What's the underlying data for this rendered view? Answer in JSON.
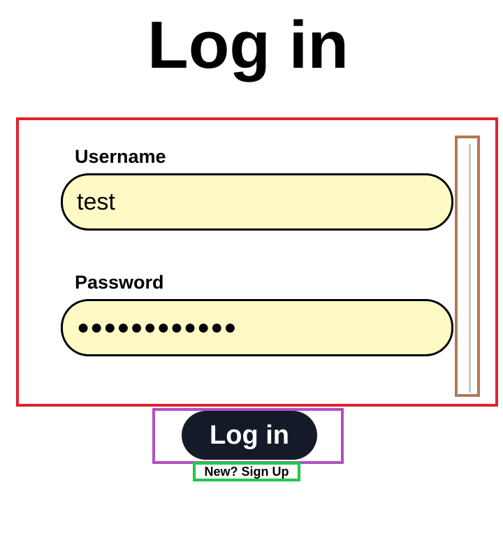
{
  "page": {
    "title": "Log in"
  },
  "form": {
    "username": {
      "label": "Username",
      "value": "test"
    },
    "password": {
      "label": "Password",
      "value": "●●●●●●●●●●●●"
    },
    "submit_label": "Log in",
    "signup_label": "New? Sign Up"
  },
  "colors": {
    "form_border": "#e0222f",
    "input_background": "#fefac6",
    "scroll_border": "#b07a56",
    "submit_border": "#b34fbd",
    "submit_background": "#141a27",
    "signup_border": "#1ec94b"
  }
}
